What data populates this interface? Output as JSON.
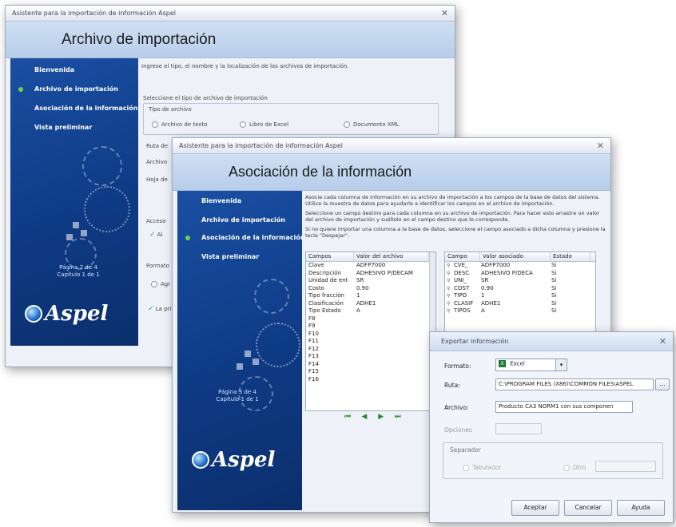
{
  "win1": {
    "title": "Asistente para la importación de información Aspel",
    "header": "Archivo de importación",
    "steps": [
      "Bienvenida",
      "Archivo de importación",
      "Asociación de la información",
      "Vista preliminar"
    ],
    "page_info": "Página 2 de 4\nCapítulo 1 de 1",
    "description": "Ingrese el tipo, el nombre y la localización de los archivos de importación.",
    "select_label": "Seleccione el tipo de archivo de importación",
    "group_label": "Tipo de archivo",
    "options": [
      "Archivo de texto",
      "Libro de Excel",
      "Documento XML"
    ],
    "partial_labels": [
      "Ruta de",
      "Archivo",
      "Hoja de",
      "Acceso",
      "Al",
      "Formato",
      "Agr",
      "La prim"
    ]
  },
  "win2": {
    "title": "Asistente para la importación de información Aspel",
    "header": "Asociación de la información",
    "steps": [
      "Bienvenida",
      "Archivo de importación",
      "Asociación de la información",
      "Vista preliminar"
    ],
    "page_info": "Página 3 de 4\nCapítulo 1 de 1",
    "desc1": "Asocie cada columna de información en su archivo de importación a los campos de la base de datos del sistema. Utilice la muestra de datos para ayudarle a identificar los campos en el archivo de importación.",
    "desc2": "Seleccione un campo destino para cada columna en su archivo de importación. Para hacer esto arrastre un valor del archivo de importación y suéltelo en el campo destino que le corresponde.",
    "desc3": "Si no quiere importar una columna a la base de datos, seleccione el campo asociado a dicha columna y presione la tecla \"Despejar\".",
    "left_table": {
      "headers": [
        "Campos",
        "Valor del archivo"
      ],
      "rows": [
        [
          "Clave",
          "ADFP7000"
        ],
        [
          "Descripción",
          "ADHESIVO P/DECAM"
        ],
        [
          "Unidad de ent",
          "SR"
        ],
        [
          "Costo",
          "0.90"
        ],
        [
          "Tipo fracción",
          "1"
        ],
        [
          "Clasificación",
          "ADHE1"
        ],
        [
          "Tipo Estado",
          "A"
        ],
        [
          "F8",
          ""
        ],
        [
          "F9",
          ""
        ],
        [
          "F10",
          ""
        ],
        [
          "F11",
          ""
        ],
        [
          "F12",
          ""
        ],
        [
          "F13",
          ""
        ],
        [
          "F14",
          ""
        ],
        [
          "F15",
          ""
        ],
        [
          "F16",
          ""
        ]
      ]
    },
    "right_table": {
      "headers": [
        "Campo",
        "Valor asociado",
        "Estado"
      ],
      "rows": [
        [
          "CVE_",
          "ADFP7000",
          "Si"
        ],
        [
          "DESC",
          "ADHESIVO P/DECA",
          "Si"
        ],
        [
          "UNI_",
          "SR",
          "Si"
        ],
        [
          "COST",
          "0.90",
          "Si"
        ],
        [
          "TIPO",
          "1",
          "Si"
        ],
        [
          "CLASIF",
          "ADHE1",
          "Si"
        ],
        [
          "TIPOS",
          "A",
          "Si"
        ]
      ]
    },
    "nav": [
      "⏮",
      "◀",
      "▶",
      "⏭"
    ]
  },
  "win3": {
    "title": "Exportar información",
    "formato_label": "Formato:",
    "formato_value": "Excel",
    "ruta_label": "Ruta:",
    "ruta_value": "C:\\PROGRAM FILES (X86)\\COMMON FILES\\ASPEL",
    "archivo_label": "Archivo:",
    "archivo_value": "Producto CA3 NORM1 con sus componen",
    "opciones_label": "Opciones",
    "separador_label": "Separador",
    "tabulador_label": "Tabulador",
    "otro_label": "Otro",
    "browse_label": "...",
    "aceptar": "Aceptar",
    "cancelar": "Cancelar",
    "ayuda": "Ayuda"
  },
  "brand": {
    "logo": "Aspel",
    "accent": "#0e3a84",
    "header": "#b7cde9"
  }
}
